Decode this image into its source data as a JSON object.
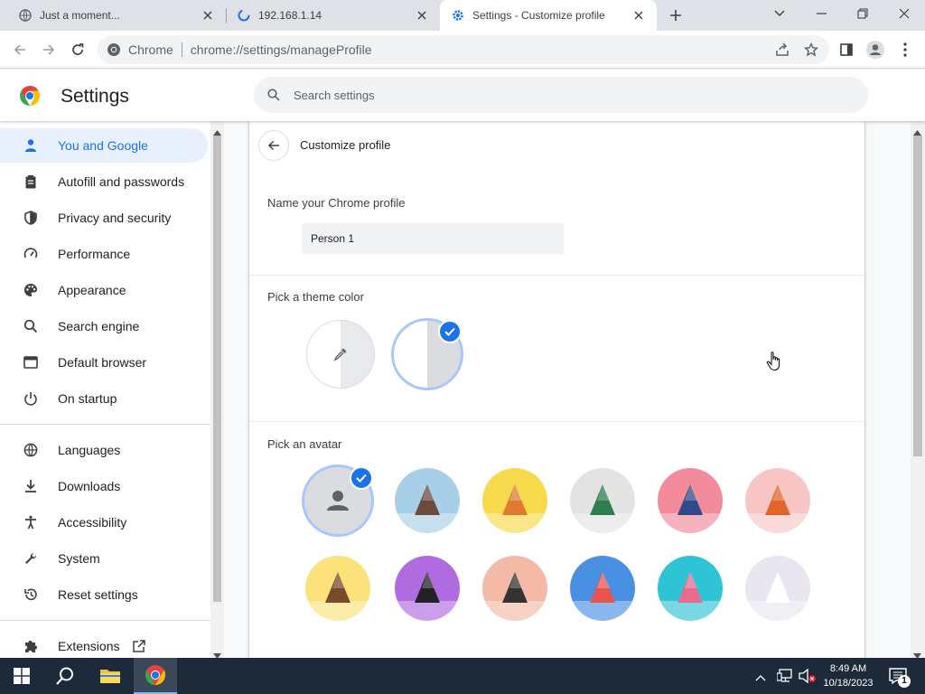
{
  "tabs": [
    {
      "title": "Just a moment...",
      "favicon": "globe-icon"
    },
    {
      "title": "192.168.1.14",
      "favicon": "loading-icon"
    },
    {
      "title": "Settings - Customize profile",
      "favicon": "gear-icon"
    }
  ],
  "toolbar": {
    "site_chip": "Chrome",
    "url": "chrome://settings/manageProfile"
  },
  "header": {
    "title": "Settings",
    "search_placeholder": "Search settings"
  },
  "sidebar": {
    "items": [
      {
        "label": "You and Google",
        "icon": "person-icon",
        "active": true
      },
      {
        "label": "Autofill and passwords",
        "icon": "clipboard-icon"
      },
      {
        "label": "Privacy and security",
        "icon": "shield-icon"
      },
      {
        "label": "Performance",
        "icon": "speedometer-icon"
      },
      {
        "label": "Appearance",
        "icon": "palette-icon"
      },
      {
        "label": "Search engine",
        "icon": "search-icon"
      },
      {
        "label": "Default browser",
        "icon": "browser-icon"
      },
      {
        "label": "On startup",
        "icon": "power-icon"
      },
      {
        "label": "Languages",
        "icon": "globe-icon"
      },
      {
        "label": "Downloads",
        "icon": "download-icon"
      },
      {
        "label": "Accessibility",
        "icon": "accessibility-icon"
      },
      {
        "label": "System",
        "icon": "wrench-icon"
      },
      {
        "label": "Reset settings",
        "icon": "reset-icon"
      },
      {
        "label": "Extensions",
        "icon": "puzzle-icon"
      }
    ]
  },
  "main": {
    "page_title": "Customize profile",
    "name_section_label": "Name your Chrome profile",
    "profile_name_value": "Person 1",
    "theme_section_label": "Pick a theme color",
    "avatar_section_label": "Pick an avatar",
    "avatars": [
      {
        "name": "default-person",
        "bg": "#dadce0"
      },
      {
        "name": "origami-cat",
        "bg": "#a8cfe8"
      },
      {
        "name": "origami-fox",
        "bg": "#f7d94c"
      },
      {
        "name": "origami-dragon",
        "bg": "#e3e3e3"
      },
      {
        "name": "origami-elephant",
        "bg": "#f28b9b"
      },
      {
        "name": "origami-fox-orange",
        "bg": "#f9c6c6"
      },
      {
        "name": "origami-monkey",
        "bg": "#fbe27a"
      },
      {
        "name": "origami-panda",
        "bg": "#b06be0"
      },
      {
        "name": "origami-penguin",
        "bg": "#f4b9a7"
      },
      {
        "name": "origami-bird",
        "bg": "#4a90e2"
      },
      {
        "name": "origami-rabbit",
        "bg": "#2ec4d6"
      },
      {
        "name": "origami-unicorn",
        "bg": "#e9e6f0"
      }
    ]
  },
  "taskbar": {
    "time": "8:49 AM",
    "date": "10/18/2023",
    "notification_count": "1"
  },
  "colors": {
    "accent": "#1a73e8",
    "active_nav_bg": "#e8f0fe",
    "taskbar": "#1c2a3a"
  }
}
